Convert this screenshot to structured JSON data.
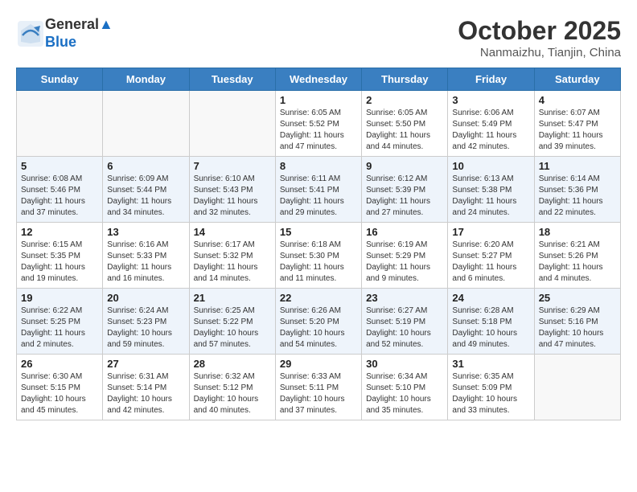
{
  "header": {
    "logo_line1": "General",
    "logo_line2": "Blue",
    "month": "October 2025",
    "location": "Nanmaizhu, Tianjin, China"
  },
  "weekdays": [
    "Sunday",
    "Monday",
    "Tuesday",
    "Wednesday",
    "Thursday",
    "Friday",
    "Saturday"
  ],
  "weeks": [
    [
      {
        "day": "",
        "info": ""
      },
      {
        "day": "",
        "info": ""
      },
      {
        "day": "",
        "info": ""
      },
      {
        "day": "1",
        "info": "Sunrise: 6:05 AM\nSunset: 5:52 PM\nDaylight: 11 hours\nand 47 minutes."
      },
      {
        "day": "2",
        "info": "Sunrise: 6:05 AM\nSunset: 5:50 PM\nDaylight: 11 hours\nand 44 minutes."
      },
      {
        "day": "3",
        "info": "Sunrise: 6:06 AM\nSunset: 5:49 PM\nDaylight: 11 hours\nand 42 minutes."
      },
      {
        "day": "4",
        "info": "Sunrise: 6:07 AM\nSunset: 5:47 PM\nDaylight: 11 hours\nand 39 minutes."
      }
    ],
    [
      {
        "day": "5",
        "info": "Sunrise: 6:08 AM\nSunset: 5:46 PM\nDaylight: 11 hours\nand 37 minutes."
      },
      {
        "day": "6",
        "info": "Sunrise: 6:09 AM\nSunset: 5:44 PM\nDaylight: 11 hours\nand 34 minutes."
      },
      {
        "day": "7",
        "info": "Sunrise: 6:10 AM\nSunset: 5:43 PM\nDaylight: 11 hours\nand 32 minutes."
      },
      {
        "day": "8",
        "info": "Sunrise: 6:11 AM\nSunset: 5:41 PM\nDaylight: 11 hours\nand 29 minutes."
      },
      {
        "day": "9",
        "info": "Sunrise: 6:12 AM\nSunset: 5:39 PM\nDaylight: 11 hours\nand 27 minutes."
      },
      {
        "day": "10",
        "info": "Sunrise: 6:13 AM\nSunset: 5:38 PM\nDaylight: 11 hours\nand 24 minutes."
      },
      {
        "day": "11",
        "info": "Sunrise: 6:14 AM\nSunset: 5:36 PM\nDaylight: 11 hours\nand 22 minutes."
      }
    ],
    [
      {
        "day": "12",
        "info": "Sunrise: 6:15 AM\nSunset: 5:35 PM\nDaylight: 11 hours\nand 19 minutes."
      },
      {
        "day": "13",
        "info": "Sunrise: 6:16 AM\nSunset: 5:33 PM\nDaylight: 11 hours\nand 16 minutes."
      },
      {
        "day": "14",
        "info": "Sunrise: 6:17 AM\nSunset: 5:32 PM\nDaylight: 11 hours\nand 14 minutes."
      },
      {
        "day": "15",
        "info": "Sunrise: 6:18 AM\nSunset: 5:30 PM\nDaylight: 11 hours\nand 11 minutes."
      },
      {
        "day": "16",
        "info": "Sunrise: 6:19 AM\nSunset: 5:29 PM\nDaylight: 11 hours\nand 9 minutes."
      },
      {
        "day": "17",
        "info": "Sunrise: 6:20 AM\nSunset: 5:27 PM\nDaylight: 11 hours\nand 6 minutes."
      },
      {
        "day": "18",
        "info": "Sunrise: 6:21 AM\nSunset: 5:26 PM\nDaylight: 11 hours\nand 4 minutes."
      }
    ],
    [
      {
        "day": "19",
        "info": "Sunrise: 6:22 AM\nSunset: 5:25 PM\nDaylight: 11 hours\nand 2 minutes."
      },
      {
        "day": "20",
        "info": "Sunrise: 6:24 AM\nSunset: 5:23 PM\nDaylight: 10 hours\nand 59 minutes."
      },
      {
        "day": "21",
        "info": "Sunrise: 6:25 AM\nSunset: 5:22 PM\nDaylight: 10 hours\nand 57 minutes."
      },
      {
        "day": "22",
        "info": "Sunrise: 6:26 AM\nSunset: 5:20 PM\nDaylight: 10 hours\nand 54 minutes."
      },
      {
        "day": "23",
        "info": "Sunrise: 6:27 AM\nSunset: 5:19 PM\nDaylight: 10 hours\nand 52 minutes."
      },
      {
        "day": "24",
        "info": "Sunrise: 6:28 AM\nSunset: 5:18 PM\nDaylight: 10 hours\nand 49 minutes."
      },
      {
        "day": "25",
        "info": "Sunrise: 6:29 AM\nSunset: 5:16 PM\nDaylight: 10 hours\nand 47 minutes."
      }
    ],
    [
      {
        "day": "26",
        "info": "Sunrise: 6:30 AM\nSunset: 5:15 PM\nDaylight: 10 hours\nand 45 minutes."
      },
      {
        "day": "27",
        "info": "Sunrise: 6:31 AM\nSunset: 5:14 PM\nDaylight: 10 hours\nand 42 minutes."
      },
      {
        "day": "28",
        "info": "Sunrise: 6:32 AM\nSunset: 5:12 PM\nDaylight: 10 hours\nand 40 minutes."
      },
      {
        "day": "29",
        "info": "Sunrise: 6:33 AM\nSunset: 5:11 PM\nDaylight: 10 hours\nand 37 minutes."
      },
      {
        "day": "30",
        "info": "Sunrise: 6:34 AM\nSunset: 5:10 PM\nDaylight: 10 hours\nand 35 minutes."
      },
      {
        "day": "31",
        "info": "Sunrise: 6:35 AM\nSunset: 5:09 PM\nDaylight: 10 hours\nand 33 minutes."
      },
      {
        "day": "",
        "info": ""
      }
    ]
  ]
}
